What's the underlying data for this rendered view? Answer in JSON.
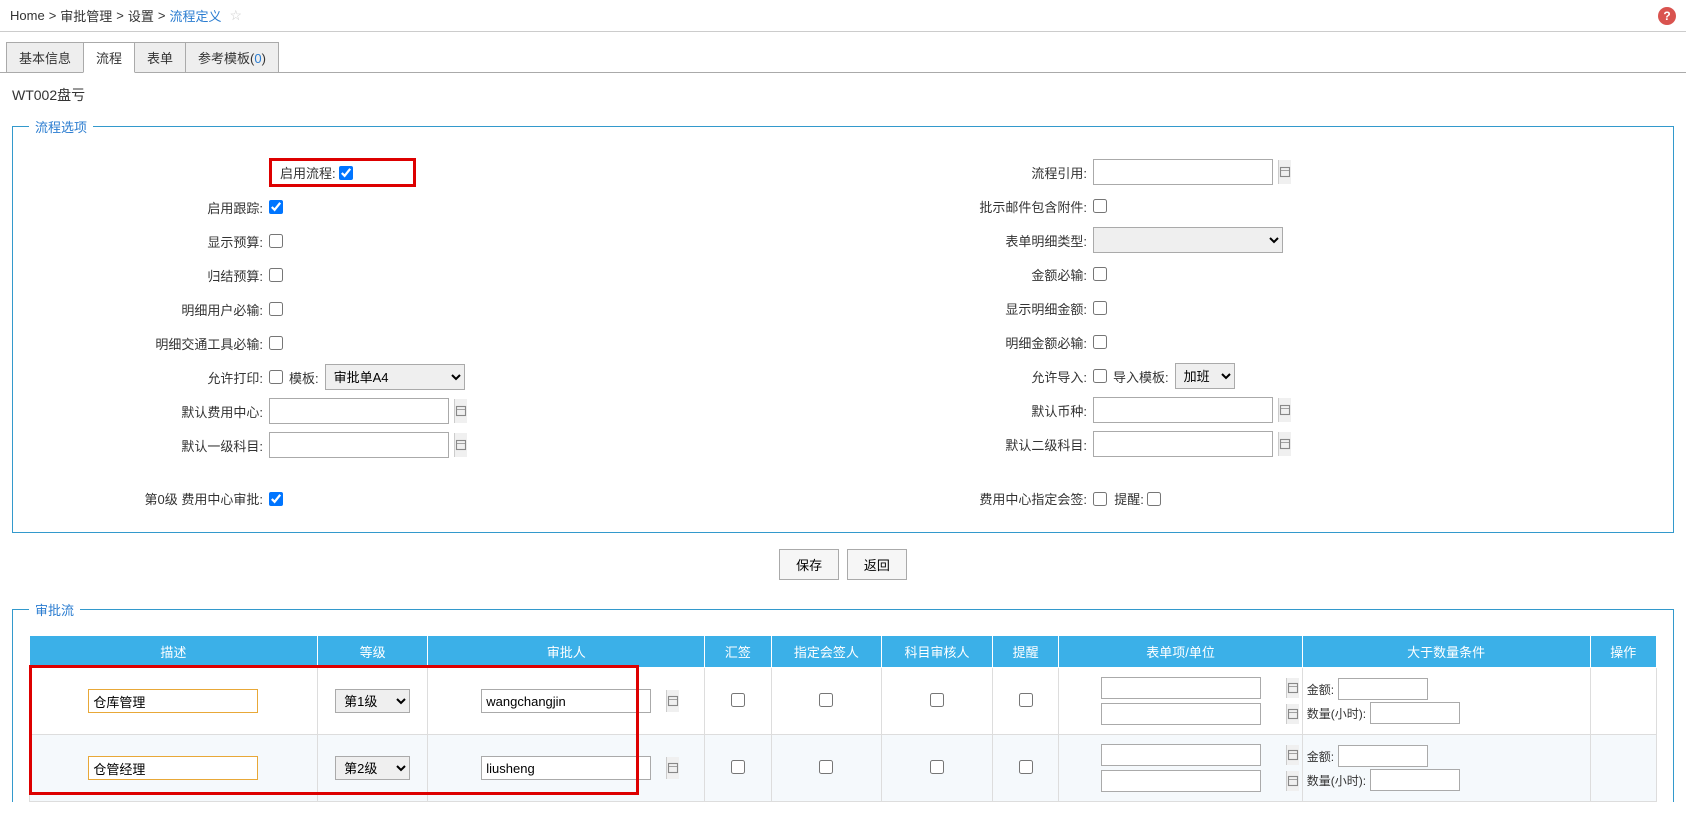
{
  "breadcrumb": {
    "home": "Home",
    "sep": ">",
    "l1": "审批管理",
    "l2": "设置",
    "current": "流程定义"
  },
  "tabs": {
    "basic": "基本信息",
    "process": "流程",
    "form": "表单",
    "template": "参考模板(",
    "template_count": "0",
    "template_close": ")"
  },
  "page_title": "WT002盘亏",
  "fieldset1_legend": "流程选项",
  "left": {
    "enable_process": "启用流程:",
    "enable_trace": "启用跟踪:",
    "show_budget": "显示预算:",
    "summary_budget": "归结预算:",
    "detail_user_required": "明细用户必输:",
    "detail_transport_required": "明细交通工具必输:",
    "allow_print": "允许打印:",
    "template_label": "模板:",
    "template_value": "审批单A4",
    "default_cost_center": "默认费用中心:",
    "default_l1_subject": "默认一级科目:"
  },
  "right": {
    "process_ref": "流程引用:",
    "approval_mail_attach": "批示邮件包含附件:",
    "form_detail_type": "表单明细类型:",
    "amount_required": "金额必输:",
    "show_detail_amount": "显示明细金额:",
    "detail_amount_required": "明细金额必输:",
    "allow_import": "允许导入:",
    "import_template_label": "导入模板:",
    "import_template_value": "加班",
    "default_currency": "默认币种:",
    "default_l2_subject": "默认二级科目:"
  },
  "bottom": {
    "level0_label": "第0级  费用中心审批:",
    "cc_countersign": "费用中心指定会签:",
    "remind": "提醒:"
  },
  "buttons": {
    "save": "保存",
    "back": "返回"
  },
  "fieldset2_legend": "审批流",
  "table": {
    "headers": {
      "desc": "描述",
      "level": "等级",
      "approver": "审批人",
      "countersign": "汇签",
      "assign_countersign": "指定会签人",
      "subject_reviewer": "科目审核人",
      "remind": "提醒",
      "form_item_unit": "表单项/单位",
      "gt_qty_cond": "大于数量条件",
      "op": "操作"
    },
    "rows": [
      {
        "desc": "仓库管理",
        "level": "第1级",
        "approver": "wangchangjin"
      },
      {
        "desc": "仓管经理",
        "level": "第2级",
        "approver": "liusheng"
      }
    ],
    "cond": {
      "amount": "金额:",
      "qty": "数量(小时):"
    }
  }
}
